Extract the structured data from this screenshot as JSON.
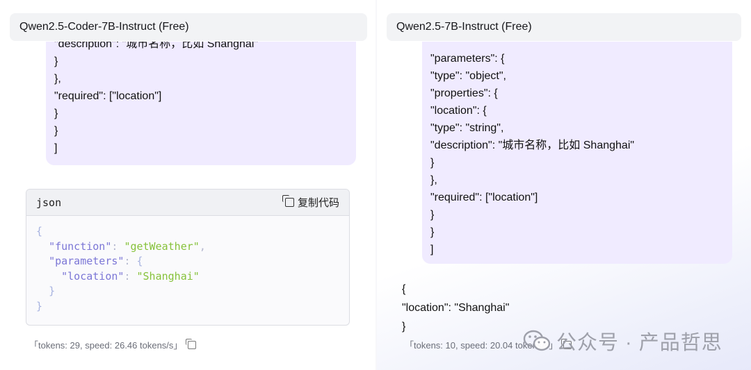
{
  "left": {
    "model_name": "Qwen2.5-Coder-7B-Instruct (Free)",
    "bubble_lines": [
      "\"description\": \"城市名称，比如 Shanghai\"",
      "}",
      "},",
      "\"required\": [\"location\"]",
      "}",
      "}",
      "]"
    ],
    "code_block": {
      "language": "json",
      "copy_label": "复制代码",
      "lines": [
        {
          "indent": "",
          "key": "",
          "sep": "",
          "value": "",
          "open": "{"
        },
        {
          "indent": "  ",
          "key": "\"function\"",
          "sep": ": ",
          "value": "\"getWeather\"",
          "open": ","
        },
        {
          "indent": "  ",
          "key": "\"parameters\"",
          "sep": ": ",
          "value": "",
          "open": "{"
        },
        {
          "indent": "    ",
          "key": "\"location\"",
          "sep": ": ",
          "value": "\"Shanghai\"",
          "open": ""
        },
        {
          "indent": "  ",
          "key": "",
          "sep": "",
          "value": "",
          "open": "}"
        },
        {
          "indent": "",
          "key": "",
          "sep": "",
          "value": "",
          "open": "}"
        }
      ]
    },
    "stats": "「tokens: 29, speed: 26.46 tokens/s」"
  },
  "right": {
    "model_name": "Qwen2.5-7B-Instruct (Free)",
    "bubble_lines": [
      "\"parameters\": {",
      "\"type\": \"object\",",
      "\"properties\": {",
      "\"location\": {",
      "\"type\": \"string\",",
      "\"description\": \"城市名称，比如 Shanghai\"",
      "}",
      "},",
      "\"required\": [\"location\"]",
      "}",
      "}",
      "]"
    ],
    "answer_lines": [
      "{",
      "\"location\": \"Shanghai\"",
      "}"
    ],
    "stats": "「tokens: 10, speed: 20.04 tokens/s」"
  },
  "watermark": {
    "text": "公众号 · 产品哲思",
    "icon": "wechat-icon"
  },
  "colors": {
    "bubble_bg": "#f0ebff",
    "header_bg": "#f2f3f5",
    "json_key": "#7b76d6",
    "json_string": "#86c23a"
  }
}
